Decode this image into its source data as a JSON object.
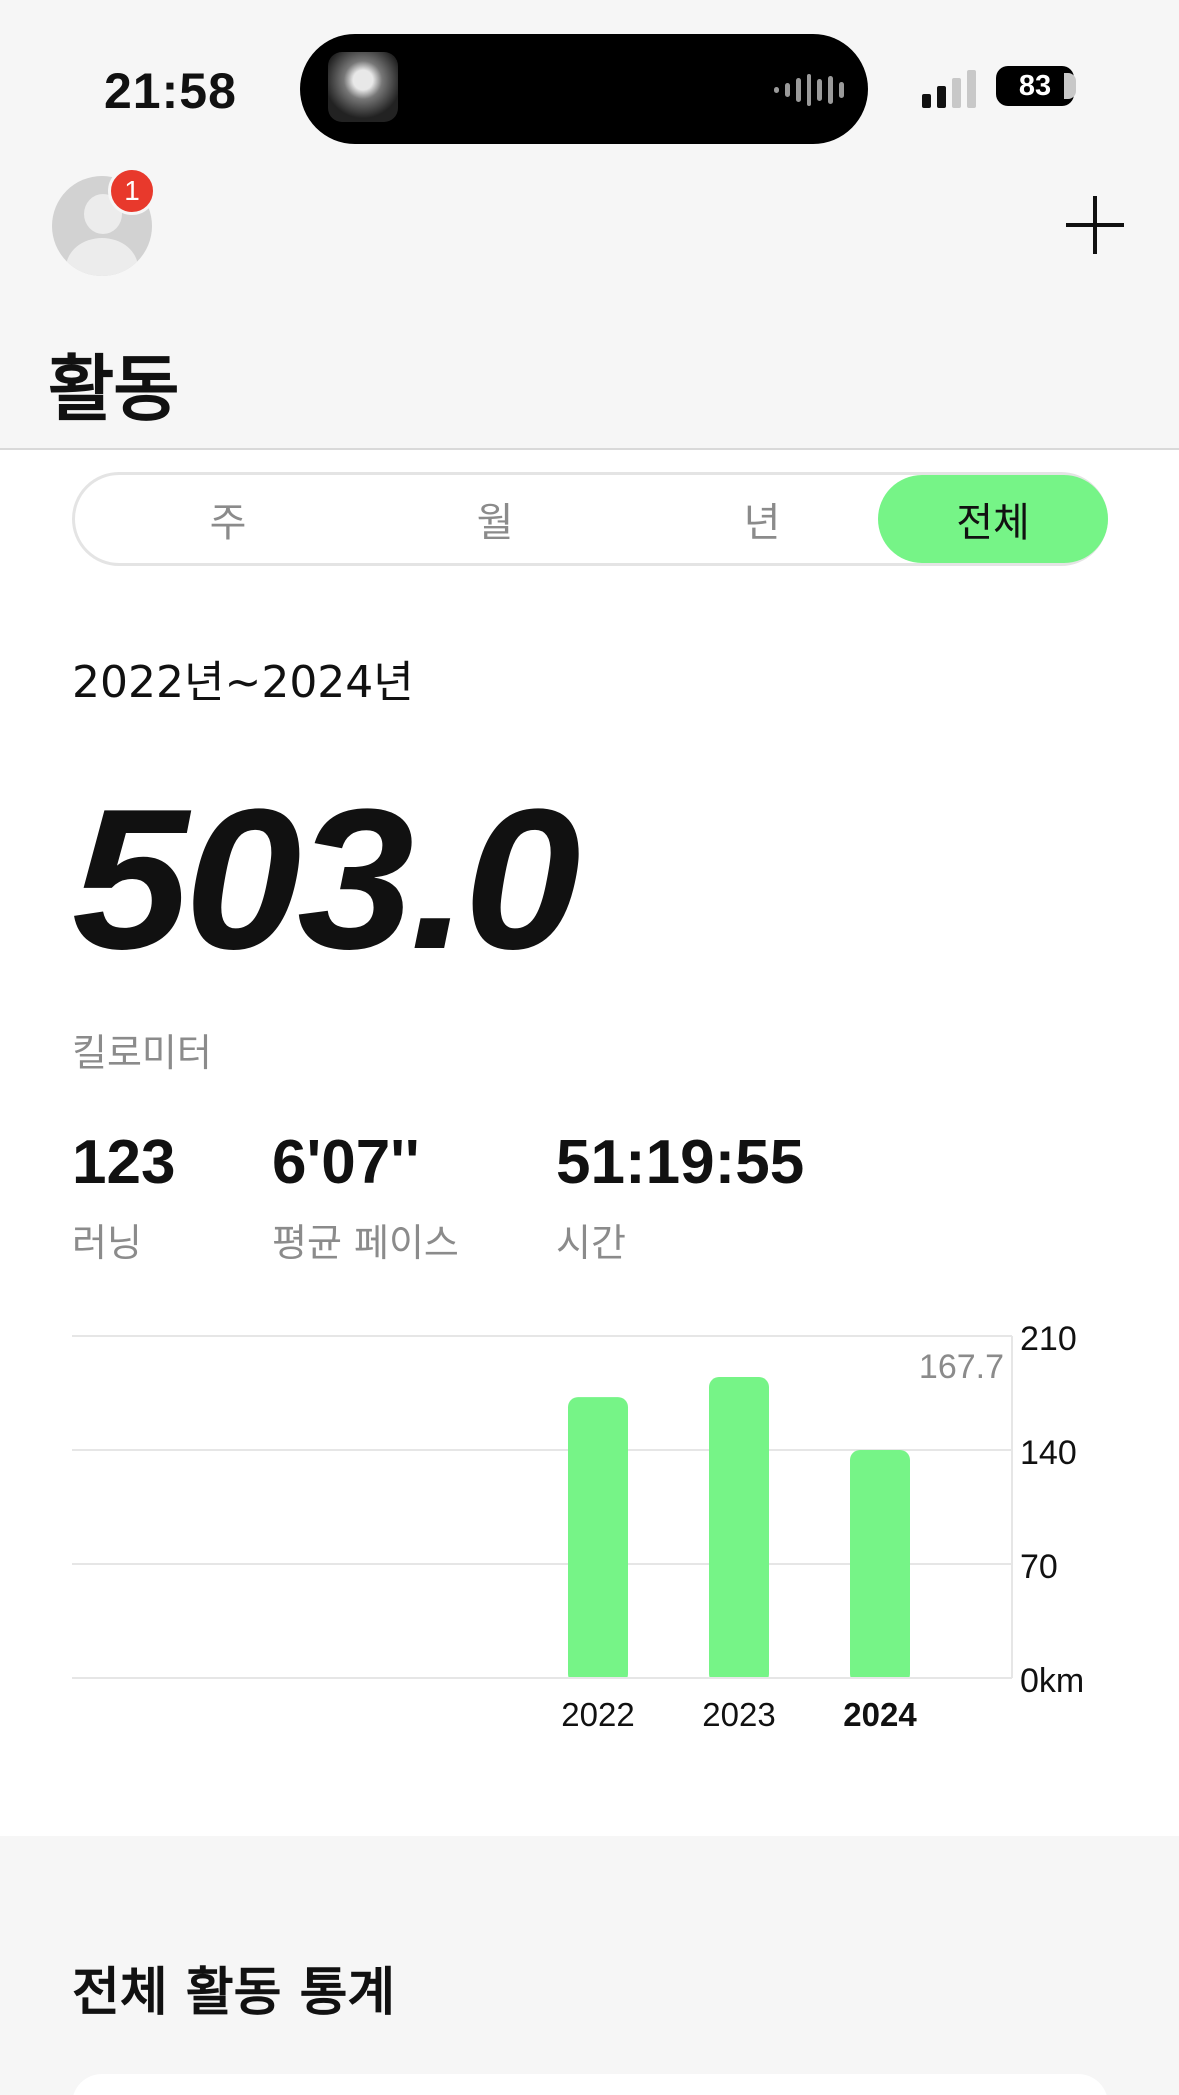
{
  "status_bar": {
    "time": "21:58",
    "battery": "83"
  },
  "header": {
    "notification_count": "1",
    "title": "활동"
  },
  "tabs": [
    {
      "label": "주",
      "active": false
    },
    {
      "label": "월",
      "active": false
    },
    {
      "label": "년",
      "active": false
    },
    {
      "label": "전체",
      "active": true
    }
  ],
  "summary": {
    "period": "2022년~2024년",
    "total_distance": "503.0",
    "distance_unit": "킬로미터",
    "stats": [
      {
        "value": "123",
        "label": "러닝"
      },
      {
        "value": "6'07''",
        "label": "평균 페이스"
      },
      {
        "value": "51:19:55",
        "label": "시간"
      }
    ]
  },
  "colors": {
    "accent": "#76f487",
    "badge": "#e8392c"
  },
  "chart_data": {
    "type": "bar",
    "categories": [
      "2022",
      "2023",
      "2024"
    ],
    "values": [
      172.5,
      184.8,
      140.0
    ],
    "y_ticks": [
      "210",
      "140",
      "70",
      "0km"
    ],
    "ylim": [
      0,
      210
    ],
    "reference_label": "167.7",
    "reference_value": 167.7,
    "highlighted_category": "2024",
    "grid": true
  },
  "section": {
    "title": "전체 활동 통계"
  }
}
